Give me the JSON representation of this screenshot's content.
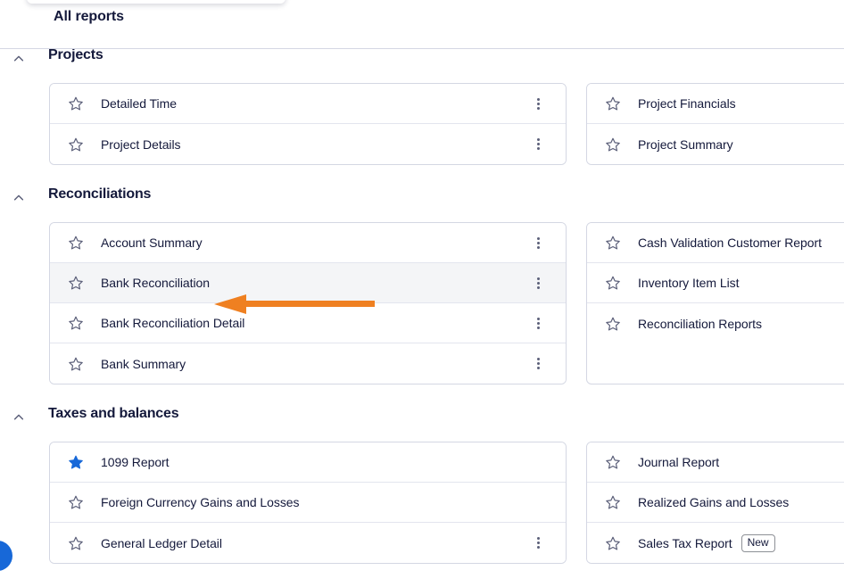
{
  "header": {
    "title": "All reports"
  },
  "icons": {
    "collapse": "chevron-up-icon",
    "star_outline": "star-outline-icon",
    "star_filled": "star-filled-icon",
    "kebab": "more-vertical-icon",
    "arrow": "arrow-left-annotation",
    "help": "help-bubble-icon"
  },
  "colors": {
    "accent_blue": "#1768d8",
    "annotation_orange": "#ef8021",
    "text": "#14193b",
    "border": "#d4d7e3",
    "row_hover": "#f4f5f7"
  },
  "groups": [
    {
      "title": "Projects",
      "collapsed": false,
      "columns": [
        {
          "rows": [
            {
              "name": "Detailed Time",
              "favorite": false,
              "kebab": true,
              "hovered": false,
              "badge": null
            },
            {
              "name": "Project Details",
              "favorite": false,
              "kebab": true,
              "hovered": false,
              "badge": null
            }
          ]
        },
        {
          "rows": [
            {
              "name": "Project Financials",
              "favorite": false,
              "kebab": true,
              "hovered": false,
              "badge": null
            },
            {
              "name": "Project Summary",
              "favorite": false,
              "kebab": true,
              "hovered": false,
              "badge": null
            }
          ]
        }
      ]
    },
    {
      "title": "Reconciliations",
      "collapsed": false,
      "columns": [
        {
          "rows": [
            {
              "name": "Account Summary",
              "favorite": false,
              "kebab": true,
              "hovered": false,
              "badge": null
            },
            {
              "name": "Bank Reconciliation",
              "favorite": false,
              "kebab": true,
              "hovered": true,
              "badge": null
            },
            {
              "name": "Bank Reconciliation Detail",
              "favorite": false,
              "kebab": true,
              "hovered": false,
              "badge": null
            },
            {
              "name": "Bank Summary",
              "favorite": false,
              "kebab": true,
              "hovered": false,
              "badge": null
            }
          ]
        },
        {
          "rows": [
            {
              "name": "Cash Validation Customer Report",
              "favorite": false,
              "kebab": true,
              "hovered": false,
              "badge": null
            },
            {
              "name": "Inventory Item List",
              "favorite": false,
              "kebab": true,
              "hovered": false,
              "badge": null
            },
            {
              "name": "Reconciliation Reports",
              "favorite": false,
              "kebab": true,
              "hovered": false,
              "badge": null
            }
          ]
        }
      ]
    },
    {
      "title": "Taxes and balances",
      "collapsed": false,
      "columns": [
        {
          "rows": [
            {
              "name": "1099 Report",
              "favorite": true,
              "kebab": false,
              "hovered": false,
              "badge": null
            },
            {
              "name": "Foreign Currency Gains and Losses",
              "favorite": false,
              "kebab": false,
              "hovered": false,
              "badge": null
            },
            {
              "name": "General Ledger Detail",
              "favorite": false,
              "kebab": true,
              "hovered": false,
              "badge": null
            }
          ]
        },
        {
          "rows": [
            {
              "name": "Journal Report",
              "favorite": false,
              "kebab": false,
              "hovered": false,
              "badge": null
            },
            {
              "name": "Realized Gains and Losses",
              "favorite": false,
              "kebab": false,
              "hovered": false,
              "badge": null
            },
            {
              "name": "Sales Tax Report",
              "favorite": false,
              "kebab": false,
              "hovered": false,
              "badge": "New"
            }
          ]
        }
      ]
    }
  ]
}
